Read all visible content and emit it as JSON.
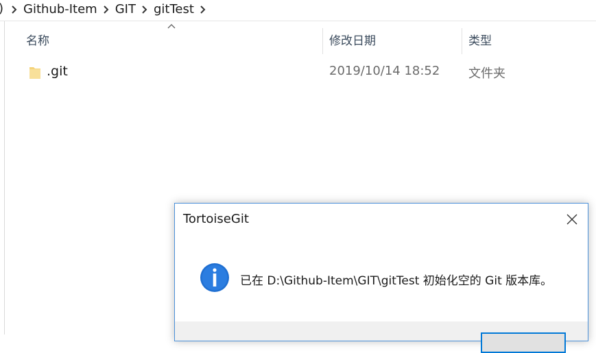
{
  "breadcrumb": {
    "edge_char": ")",
    "items": [
      "Github-Item",
      "GIT",
      "gitTest"
    ]
  },
  "columns": {
    "name": "名称",
    "modified": "修改日期",
    "type": "类型"
  },
  "files": [
    {
      "name": ".git",
      "modified": "2019/10/14 18:52",
      "type": "文件夹"
    }
  ],
  "dialog": {
    "title": "TortoiseGit",
    "message": "已在 D:\\Github-Item\\GIT\\gitTest 初始化空的 Git 版本库。",
    "icon": "info-icon"
  },
  "colors": {
    "accent": "#0078d7",
    "dialog_border": "#4a90d9",
    "folder": "#f5d37a"
  }
}
